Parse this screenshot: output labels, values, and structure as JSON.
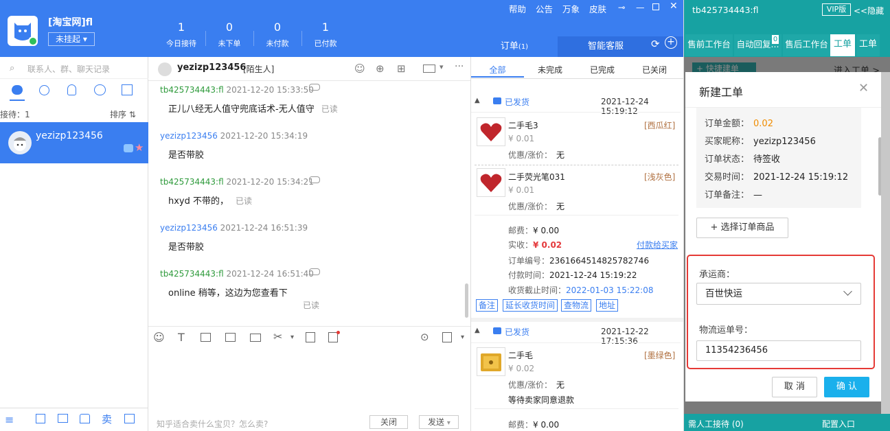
{
  "header": {
    "shop_name": "[淘宝网]fl",
    "status": "未挂起",
    "links": [
      "帮助",
      "公告",
      "万象",
      "皮肤"
    ],
    "stats": [
      {
        "value": "1",
        "label": "今日接待"
      },
      {
        "value": "0",
        "label": "未下单"
      },
      {
        "value": "0",
        "label": "未付款"
      },
      {
        "value": "1",
        "label": "已付款"
      }
    ]
  },
  "contacts": {
    "search_placeholder": "联系人、群、聊天记录",
    "waiting": "接待：1",
    "sort": "排序 ⇅",
    "items": [
      {
        "name": "yezizp123456"
      }
    ]
  },
  "chat": {
    "user": "yezizp123456",
    "user_tag": "[陌生人]",
    "messages": [
      {
        "sender": "tb425734443:fl",
        "time": "2021-12-20 15:33:50",
        "text": "正儿八经无人值守兜底话术-无人值守",
        "read": "已读"
      },
      {
        "sender": "yezizp123456",
        "time": "2021-12-20 15:34:19",
        "text": "是否带胶",
        "read": ""
      },
      {
        "sender": "tb425734443:fl",
        "time": "2021-12-20 15:34:21",
        "text": "hxyd 不带的，",
        "read": "已读"
      },
      {
        "sender": "yezizp123456",
        "time": "2021-12-24 16:51:39",
        "text": "是否带胶",
        "read": ""
      },
      {
        "sender": "tb425734443:fl",
        "time": "2021-12-24 16:51:40",
        "text": "online 稍等，这边为您查看下",
        "read": "已读"
      }
    ],
    "input_hint": "知乎适合卖什么宝贝？怎么卖?",
    "close_btn": "关闭",
    "send_btn": "发送"
  },
  "orders": {
    "tabs": [
      "订单",
      "智能客服"
    ],
    "tab_badge": "(1)",
    "filters": [
      "全部",
      "未完成",
      "已完成",
      "已关闭"
    ],
    "order1": {
      "status": "已发货",
      "time": "2021-12-24 15:19:12",
      "items": [
        {
          "name": "二手毛3",
          "price": "¥ 0.01",
          "discount": "优惠/涨价：",
          "discount_val": "无",
          "color": "[西瓜红]"
        },
        {
          "name": "二手荧光笔031",
          "price": "¥ 0.01",
          "discount": "优惠/涨价：",
          "discount_val": "无",
          "color": "[浅灰色]"
        }
      ],
      "postage_lbl": "邮费：",
      "postage": "¥ 0.00",
      "paid_lbl": "实收：",
      "paid": "¥ 0.02",
      "pay_link": "付款给买家",
      "order_no_lbl": "订单编号：",
      "order_no": "2361664514825782746",
      "pay_time_lbl": "付款时间：",
      "pay_time": "2021-12-24 15:19:22",
      "deadline_lbl": "收货截止时间：",
      "deadline": "2022-01-03 15:22:08",
      "actions": [
        "备注",
        "延长收货时间",
        "查物流",
        "地址"
      ]
    },
    "order2": {
      "status": "已发货",
      "time": "2021-12-22 17:15:36",
      "item": {
        "name": "二手毛",
        "price": "¥ 0.02",
        "discount": "优惠/涨价：",
        "discount_val": "无",
        "color": "[墨绿色]",
        "note": "等待卖家同意退款"
      },
      "postage_lbl": "邮费：",
      "postage": "¥ 0.00"
    }
  },
  "right": {
    "account": "tb425734443:fl",
    "vip": "VIP版",
    "hide": "<<隐藏",
    "tabs": [
      "售前工作台",
      "自动回复...",
      "售后工作台",
      "工单",
      "工单"
    ],
    "tab_badge": "0",
    "quick_btn": "+ 快捷建单",
    "enter": "进入工单 >",
    "footer_left": "需人工接待 (0)",
    "footer_right": "配置入口"
  },
  "dialog": {
    "title": "新建工单",
    "fields": [
      {
        "label": "订单金额：",
        "value": "0.02"
      },
      {
        "label": "买家昵称：",
        "value": "yezizp123456"
      },
      {
        "label": "订单状态：",
        "value": "待签收"
      },
      {
        "label": "交易时间：",
        "value": "2021-12-24 15:19:12"
      },
      {
        "label": "订单备注：",
        "value": "—"
      }
    ],
    "select_goods": "+ 选择订单商品",
    "carrier_label": "承运商：",
    "carrier_value": "百世快运",
    "tracking_label": "物流运单号：",
    "tracking_value": "11354236456",
    "cancel": "取 消",
    "confirm": "确 认"
  },
  "colors": {
    "brand": "#3a7ef0",
    "teal": "#17a2a2",
    "price": "#e4393c",
    "amount": "#f08c00",
    "highlight": "#e53935"
  }
}
